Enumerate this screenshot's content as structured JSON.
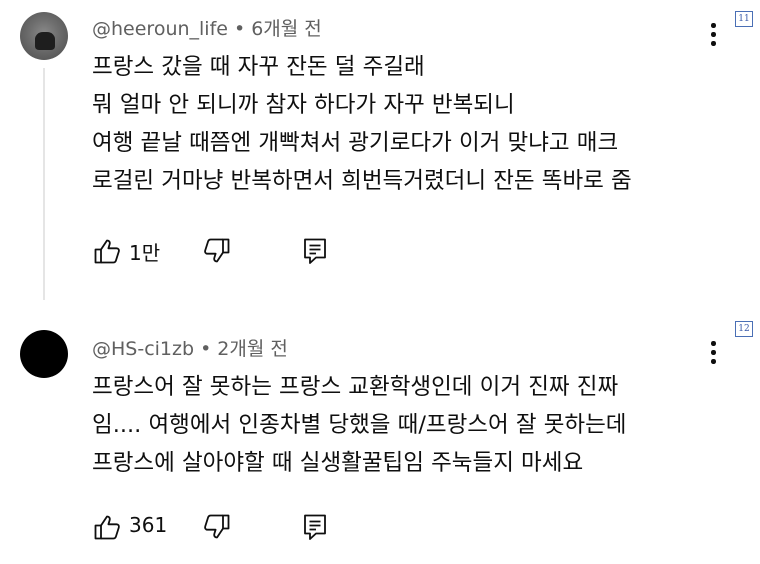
{
  "comments": [
    {
      "username": "@heeroun_life",
      "separator": "•",
      "time": "6개월 전",
      "lines": [
        "프랑스 갔을 때 자꾸 잔돈 덜 주길래",
        "뭐 얼마 안 되니까 참자 하다가 자꾸 반복되니",
        "여행 끝날 때쯤엔 개빡쳐서 광기로다가 이거 맞냐고 매크",
        "로걸린 거마냥 반복하면서 희번득거렸더니 잔돈 똑바로 줌"
      ],
      "like_count": "1만",
      "index_tag": "11",
      "icons": {
        "like": "thumbs-up-icon",
        "dislike": "thumbs-down-icon",
        "reply": "reply-comment-icon",
        "menu": "more-vertical-icon"
      }
    },
    {
      "username": "@HS-ci1zb",
      "separator": "•",
      "time": "2개월 전",
      "lines": [
        "프랑스어 잘 못하는 프랑스 교환학생인데 이거 진짜 진짜",
        "임.... 여행에서 인종차별 당했을 때/프랑스어 잘 못하는데",
        "프랑스에 살아야할 때 실생활꿀팁임 주눅들지 마세요"
      ],
      "like_count": "361",
      "index_tag": "12",
      "icons": {
        "like": "thumbs-up-icon",
        "dislike": "thumbs-down-icon",
        "reply": "reply-comment-icon",
        "menu": "more-vertical-icon"
      }
    }
  ],
  "colors": {
    "text_primary": "#0f0f0f",
    "text_secondary": "#606060",
    "thread_line": "#e5e5e5",
    "tag_border": "#4a6fb5"
  }
}
